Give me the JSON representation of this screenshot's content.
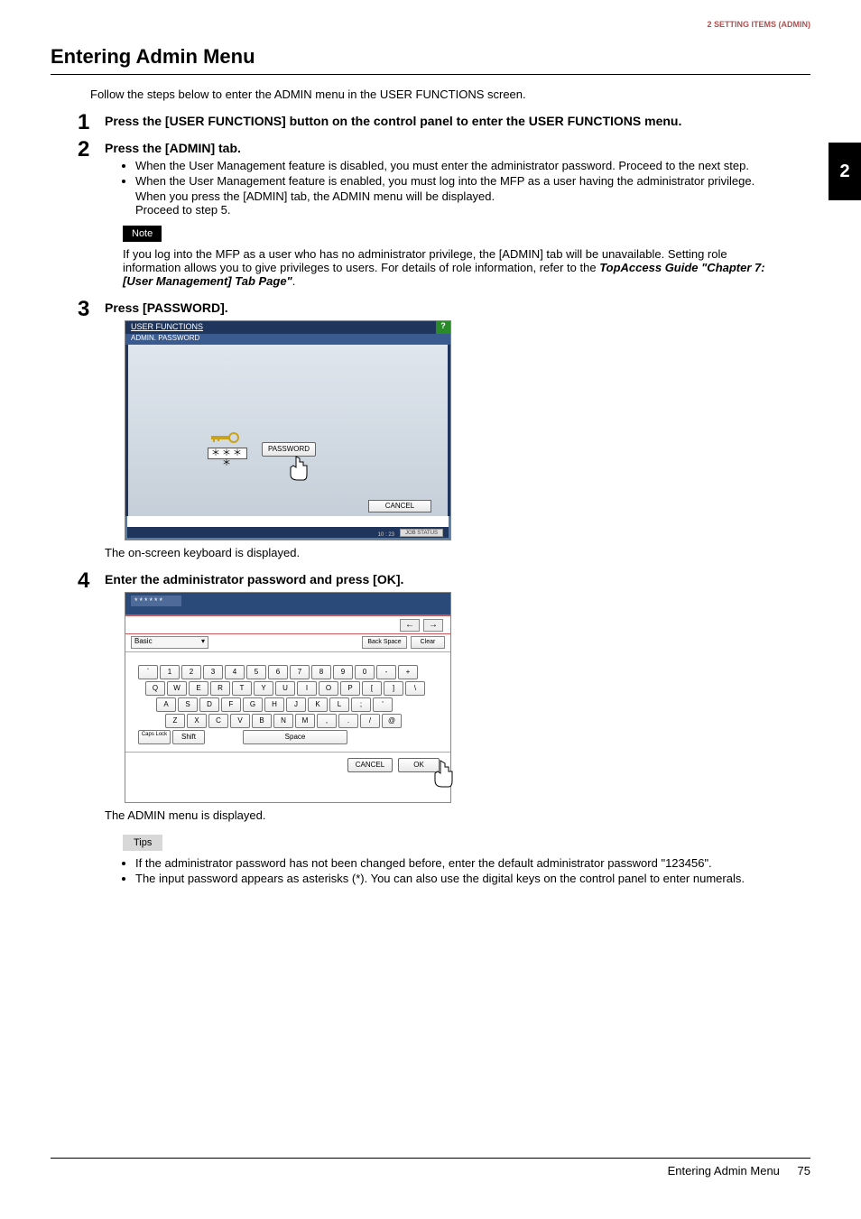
{
  "header": {
    "breadcrumb": "2 SETTING ITEMS (ADMIN)",
    "chapter_tab": "2"
  },
  "title": "Entering Admin Menu",
  "intro": "Follow the steps below to enter the ADMIN menu in the USER FUNCTIONS screen.",
  "steps": {
    "s1": {
      "num": "1",
      "title": "Press the [USER FUNCTIONS] button on the control panel to enter the USER FUNCTIONS menu."
    },
    "s2": {
      "num": "2",
      "title": "Press the [ADMIN] tab.",
      "b1": "When the User Management feature is disabled, you must enter the administrator password. Proceed to the next step.",
      "b2": "When the User Management feature is enabled, you must log into the MFP as a user having the administrator privilege.",
      "l1": "When you press the [ADMIN] tab, the ADMIN menu will be displayed.",
      "l2": "Proceed to step 5.",
      "note_label": "Note",
      "note_body": "If you log into the MFP as a user who has no administrator privilege, the [ADMIN] tab will be unavailable. Setting role information allows you to give privileges to users. For details of role information, refer to the ",
      "note_ref": "TopAccess Guide \"Chapter 7: [User Management] Tab Page\"",
      "note_tail": "."
    },
    "s3": {
      "num": "3",
      "title": "Press [PASSWORD].",
      "after": "The on-screen keyboard is displayed."
    },
    "s4": {
      "num": "4",
      "title": "Enter the administrator password and press [OK].",
      "after": "The ADMIN menu is displayed.",
      "tips_label": "Tips",
      "tip1": "If the administrator password has not been changed before, enter the default administrator password \"123456\".",
      "tip2": "The input password appears as asterisks (*). You can also use the digital keys on the control panel to enter numerals."
    }
  },
  "screen1": {
    "title": "USER FUNCTIONS",
    "sub": "ADMIN. PASSWORD",
    "help": "?",
    "masked": "＊＊＊＊",
    "password_btn": "PASSWORD",
    "cancel": "CANCEL",
    "jobstatus": "JOB STATUS",
    "time": "10 : 23"
  },
  "screen2": {
    "entry": "******",
    "arrow_left": "←",
    "arrow_right": "→",
    "mode": "Basic",
    "backspace": "Back Space",
    "clear": "Clear",
    "row1": [
      "`",
      "1",
      "2",
      "3",
      "4",
      "5",
      "6",
      "7",
      "8",
      "9",
      "0",
      "-",
      "+"
    ],
    "row2": [
      "Q",
      "W",
      "E",
      "R",
      "T",
      "Y",
      "U",
      "I",
      "O",
      "P",
      "[",
      "]",
      "\\"
    ],
    "row3": [
      "A",
      "S",
      "D",
      "F",
      "G",
      "H",
      "J",
      "K",
      "L",
      ";",
      "'"
    ],
    "row4": [
      "Z",
      "X",
      "C",
      "V",
      "B",
      "N",
      "M",
      ",",
      ".",
      "/",
      "@"
    ],
    "capslock": "Caps Lock",
    "shift": "Shift",
    "space": "Space",
    "cancel": "CANCEL",
    "ok": "OK"
  },
  "footer": {
    "label": "Entering Admin Menu",
    "page": "75"
  }
}
